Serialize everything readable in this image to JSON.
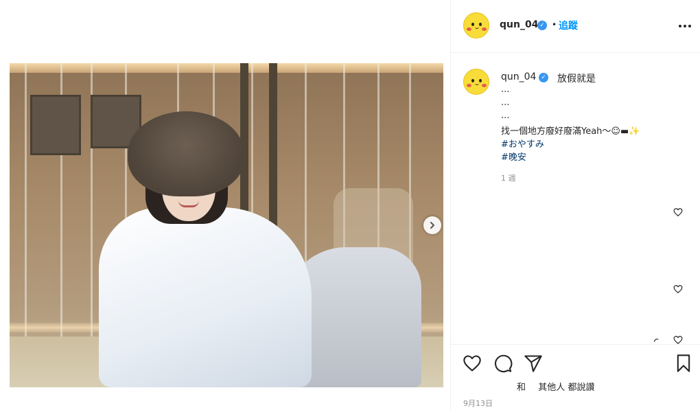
{
  "post": {
    "photo_alt": "",
    "next_icon": "chevron-right-icon"
  },
  "header": {
    "username": "qun_04",
    "verified_icon": "verified-badge-icon",
    "separator": "•",
    "follow_label": "追蹤",
    "more_icon": "more-options-icon"
  },
  "caption": {
    "username": "qun_04",
    "first_line": "放假就是",
    "lines": [
      "...",
      "...",
      "...",
      "找一個地方廢好廢滿Yeah～☺︎▬✨"
    ],
    "hashtags": [
      "#おやすみ",
      "#晚安"
    ],
    "time_ago": "1 週"
  },
  "actions": {
    "like_icon": "heart-icon",
    "comment_icon": "comment-icon",
    "share_icon": "share-icon",
    "save_icon": "bookmark-icon",
    "likes_prefix": "和",
    "likes_others": "其他人",
    "likes_suffix": "都說讚",
    "date": "9月13日"
  },
  "colors": {
    "link_blue": "#0095f6",
    "hashtag": "#00376b",
    "verified": "#3897f0",
    "avatar_yellow": "#f8dc3a"
  }
}
